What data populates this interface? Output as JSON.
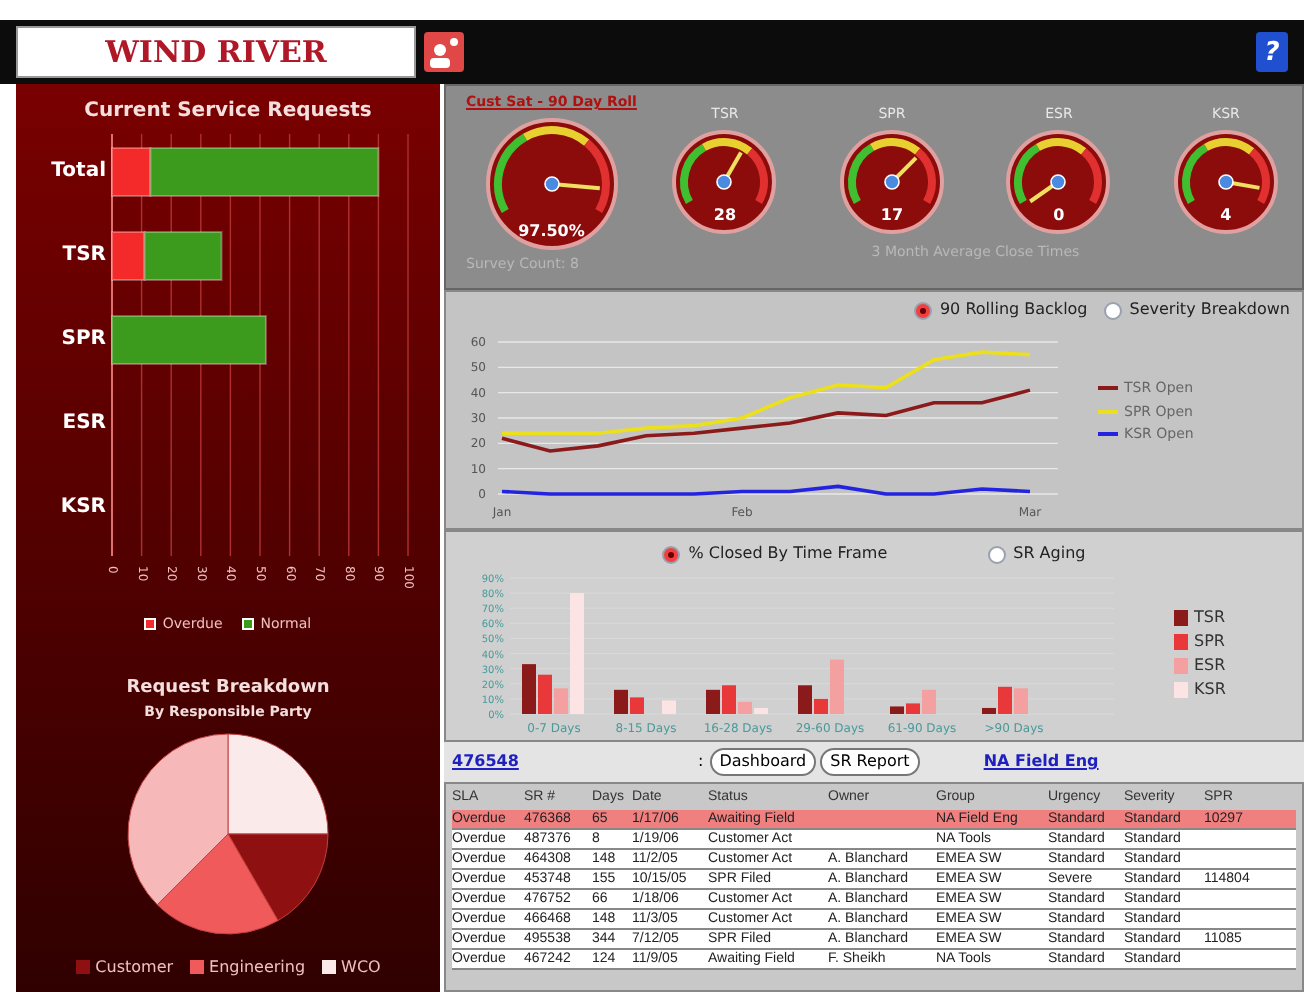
{
  "header": {
    "logo": "WIND RIVER",
    "help": "?"
  },
  "requests": {
    "chart_data": {
      "type": "bar",
      "orientation": "horizontal",
      "stacked": true,
      "title": "Current Service Requests",
      "categories": [
        "Total",
        "TSR",
        "SPR",
        "ESR",
        "KSR"
      ],
      "series": [
        {
          "name": "Overdue",
          "color": "#f42a2a",
          "values": [
            13,
            11,
            0,
            0,
            0
          ]
        },
        {
          "name": "Normal",
          "color": "#3c9a1c",
          "values": [
            77,
            26,
            52,
            0,
            0
          ]
        }
      ],
      "xlim": [
        0,
        100
      ],
      "grid": true,
      "xticks": [
        0,
        10,
        20,
        30,
        40,
        50,
        60,
        70,
        80,
        90,
        100
      ]
    }
  },
  "breakdown": {
    "title": "Request Breakdown",
    "subtitle": "By Responsible Party",
    "legend": [
      {
        "label": "Customer",
        "color": "#8e1010"
      },
      {
        "label": "Engineering",
        "color": "#f05a5a"
      },
      {
        "label": "WCO",
        "color": "#fbeaea"
      }
    ]
  },
  "gauges": {
    "link": "Cust Sat - 90 Day Roll",
    "main": {
      "reading": "97.50%"
    },
    "survey_count": "Survey Count: 8",
    "items": [
      {
        "label": "TSR",
        "reading": "28"
      },
      {
        "label": "SPR",
        "reading": "17"
      },
      {
        "label": "ESR",
        "reading": "0"
      },
      {
        "label": "KSR",
        "reading": "4"
      }
    ],
    "caption": "3 Month Average Close Times"
  },
  "backlog": {
    "options": [
      {
        "label": "90 Rolling Backlog",
        "selected": true
      },
      {
        "label": "Severity Breakdown",
        "selected": false
      }
    ],
    "chart_data": {
      "type": "line",
      "categories": [
        "Jan",
        null,
        null,
        null,
        null,
        "Feb",
        null,
        null,
        null,
        null,
        null,
        "Mar"
      ],
      "ylim": [
        0,
        60
      ],
      "grid": true,
      "yticks": [
        0,
        10,
        20,
        30,
        40,
        50,
        60
      ],
      "series": [
        {
          "name": "TSR Open",
          "color": "#8b1a1a",
          "values": [
            22,
            17,
            19,
            23,
            24,
            26,
            28,
            32,
            31,
            36,
            36,
            41
          ]
        },
        {
          "name": "SPR Open",
          "color": "#ecdf1c",
          "values": [
            24,
            24,
            24,
            26,
            27,
            30,
            38,
            43,
            42,
            53,
            56,
            55
          ]
        },
        {
          "name": "KSR Open",
          "color": "#2424e0",
          "values": [
            1,
            0,
            0,
            0,
            0,
            1,
            1,
            3,
            0,
            0,
            2,
            1
          ]
        }
      ]
    }
  },
  "closed": {
    "options": [
      {
        "label": "% Closed By Time Frame",
        "selected": true
      },
      {
        "label": "SR Aging",
        "selected": false
      }
    ],
    "chart_data": {
      "type": "bar",
      "categories": [
        "0-7 Days",
        "8-15 Days",
        "16-28 Days",
        "29-60 Days",
        "61-90 Days",
        ">90 Days"
      ],
      "ylim": [
        0,
        90
      ],
      "grid": true,
      "yticks": [
        {
          "value": 0,
          "label": "0%"
        },
        {
          "value": 10,
          "label": "10%"
        },
        {
          "value": 20,
          "label": "20%"
        },
        {
          "value": 30,
          "label": "30%"
        },
        {
          "value": 40,
          "label": "40%"
        },
        {
          "value": 50,
          "label": "50%"
        },
        {
          "value": 60,
          "label": "60%"
        },
        {
          "value": 70,
          "label": "70%"
        },
        {
          "value": 80,
          "label": "80%"
        },
        {
          "value": 90,
          "label": "90%"
        }
      ],
      "series": [
        {
          "name": "TSR",
          "color": "#8b1a1a",
          "values": [
            33,
            16,
            16,
            19,
            5,
            4
          ]
        },
        {
          "name": "SPR",
          "color": "#e8383a",
          "values": [
            26,
            11,
            19,
            10,
            7,
            18
          ]
        },
        {
          "name": "ESR",
          "color": "#f4a0a0",
          "values": [
            17,
            0,
            8,
            36,
            16,
            17
          ]
        },
        {
          "name": "KSR",
          "color": "#fde4e4",
          "values": [
            80,
            9,
            4,
            0,
            0,
            0
          ]
        }
      ]
    }
  },
  "nav": {
    "sr": "476548",
    "separator": ":",
    "buttons": [
      "Dashboard",
      "SR Report"
    ],
    "group": "NA Field Eng"
  },
  "table": {
    "columns": [
      "SLA",
      "SR #",
      "Days",
      "Date",
      "Status",
      "Owner",
      "Group",
      "Urgency",
      "Severity",
      "SPR"
    ],
    "rows": [
      {
        "selected": true,
        "cells": [
          "Overdue",
          "476368",
          "65",
          "1/17/06",
          "Awaiting Field",
          null,
          "NA Field Eng",
          "Standard",
          "Standard",
          "10297"
        ]
      },
      {
        "selected": false,
        "cells": [
          "Overdue",
          "487376",
          "8",
          "1/19/06",
          "Customer Act",
          null,
          "NA Tools",
          "Standard",
          "Standard",
          null
        ]
      },
      {
        "selected": false,
        "cells": [
          "Overdue",
          "464308",
          "148",
          "11/2/05",
          "Customer Act",
          "A. Blanchard",
          "EMEA SW",
          "Standard",
          "Standard",
          null
        ]
      },
      {
        "selected": false,
        "cells": [
          "Overdue",
          "453748",
          "155",
          "10/15/05",
          "SPR Filed",
          "A. Blanchard",
          "EMEA SW",
          "Severe",
          "Standard",
          "114804"
        ]
      },
      {
        "selected": false,
        "cells": [
          "Overdue",
          "476752",
          "66",
          "1/18/06",
          "Customer Act",
          "A. Blanchard",
          "EMEA SW",
          "Standard",
          "Standard",
          null
        ]
      },
      {
        "selected": false,
        "cells": [
          "Overdue",
          "466468",
          "148",
          "11/3/05",
          "Customer Act",
          "A. Blanchard",
          "EMEA SW",
          "Standard",
          "Standard",
          null
        ]
      },
      {
        "selected": false,
        "cells": [
          "Overdue",
          "495538",
          "344",
          "7/12/05",
          "SPR Filed",
          "A. Blanchard",
          "EMEA SW",
          "Standard",
          "Standard",
          "11085"
        ]
      },
      {
        "selected": false,
        "cells": [
          "Overdue",
          "467242",
          "124",
          "11/9/05",
          "Awaiting Field",
          "F. Sheikh",
          "NA Tools",
          "Standard",
          "Standard",
          null
        ]
      }
    ]
  }
}
